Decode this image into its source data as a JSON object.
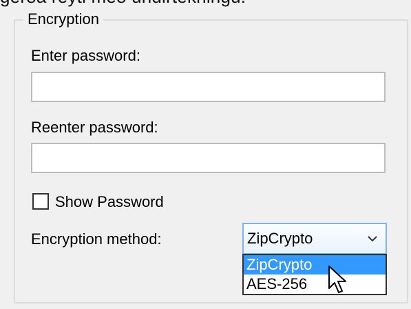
{
  "header_cut_text": "gerða reyti með undirtekningu.",
  "encryption": {
    "group_title": "Encryption",
    "enter_password_label": "Enter password:",
    "enter_password_value": "",
    "reenter_password_label": "Reenter password:",
    "reenter_password_value": "",
    "show_password_label": "Show Password",
    "show_password_checked": false,
    "method_label": "Encryption method:",
    "method_selected": "ZipCrypto",
    "method_options": [
      "ZipCrypto",
      "AES-256"
    ],
    "dropdown_open": true,
    "highlighted_option": "ZipCrypto"
  },
  "icons": {
    "dropdown_arrow": "chevron-down-icon",
    "mouse_cursor": "arrow-pointer-icon"
  },
  "colors": {
    "window_bg": "#f0f0f0",
    "highlight": "#3399ff",
    "select_border": "#7eb4ea",
    "group_border": "#dcdcdc"
  }
}
